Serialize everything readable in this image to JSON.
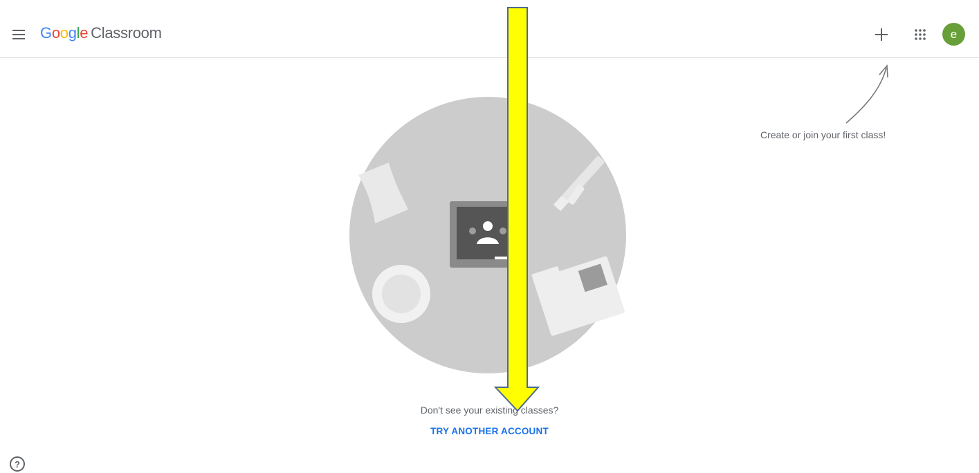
{
  "header": {
    "menu_icon": "hamburger-menu-icon",
    "brand_google": [
      "G",
      "o",
      "o",
      "g",
      "l",
      "e"
    ],
    "brand_product": "Classroom",
    "add_icon": "plus-icon",
    "apps_icon": "apps-grid-icon",
    "avatar_letter": "e",
    "avatar_color": "#689f38"
  },
  "hint": {
    "text": "Create or join your first class!",
    "icon": "curved-arrow-icon"
  },
  "empty_state": {
    "illustration": "classroom-desk-illustration",
    "existing_text": "Don't see your existing classes?",
    "try_label": "TRY ANOTHER ACCOUNT"
  },
  "footer": {
    "help_icon": "help-icon",
    "help_glyph": "?"
  },
  "annotation": {
    "icon": "yellow-down-arrow-overlay",
    "color": "#ffff00"
  }
}
